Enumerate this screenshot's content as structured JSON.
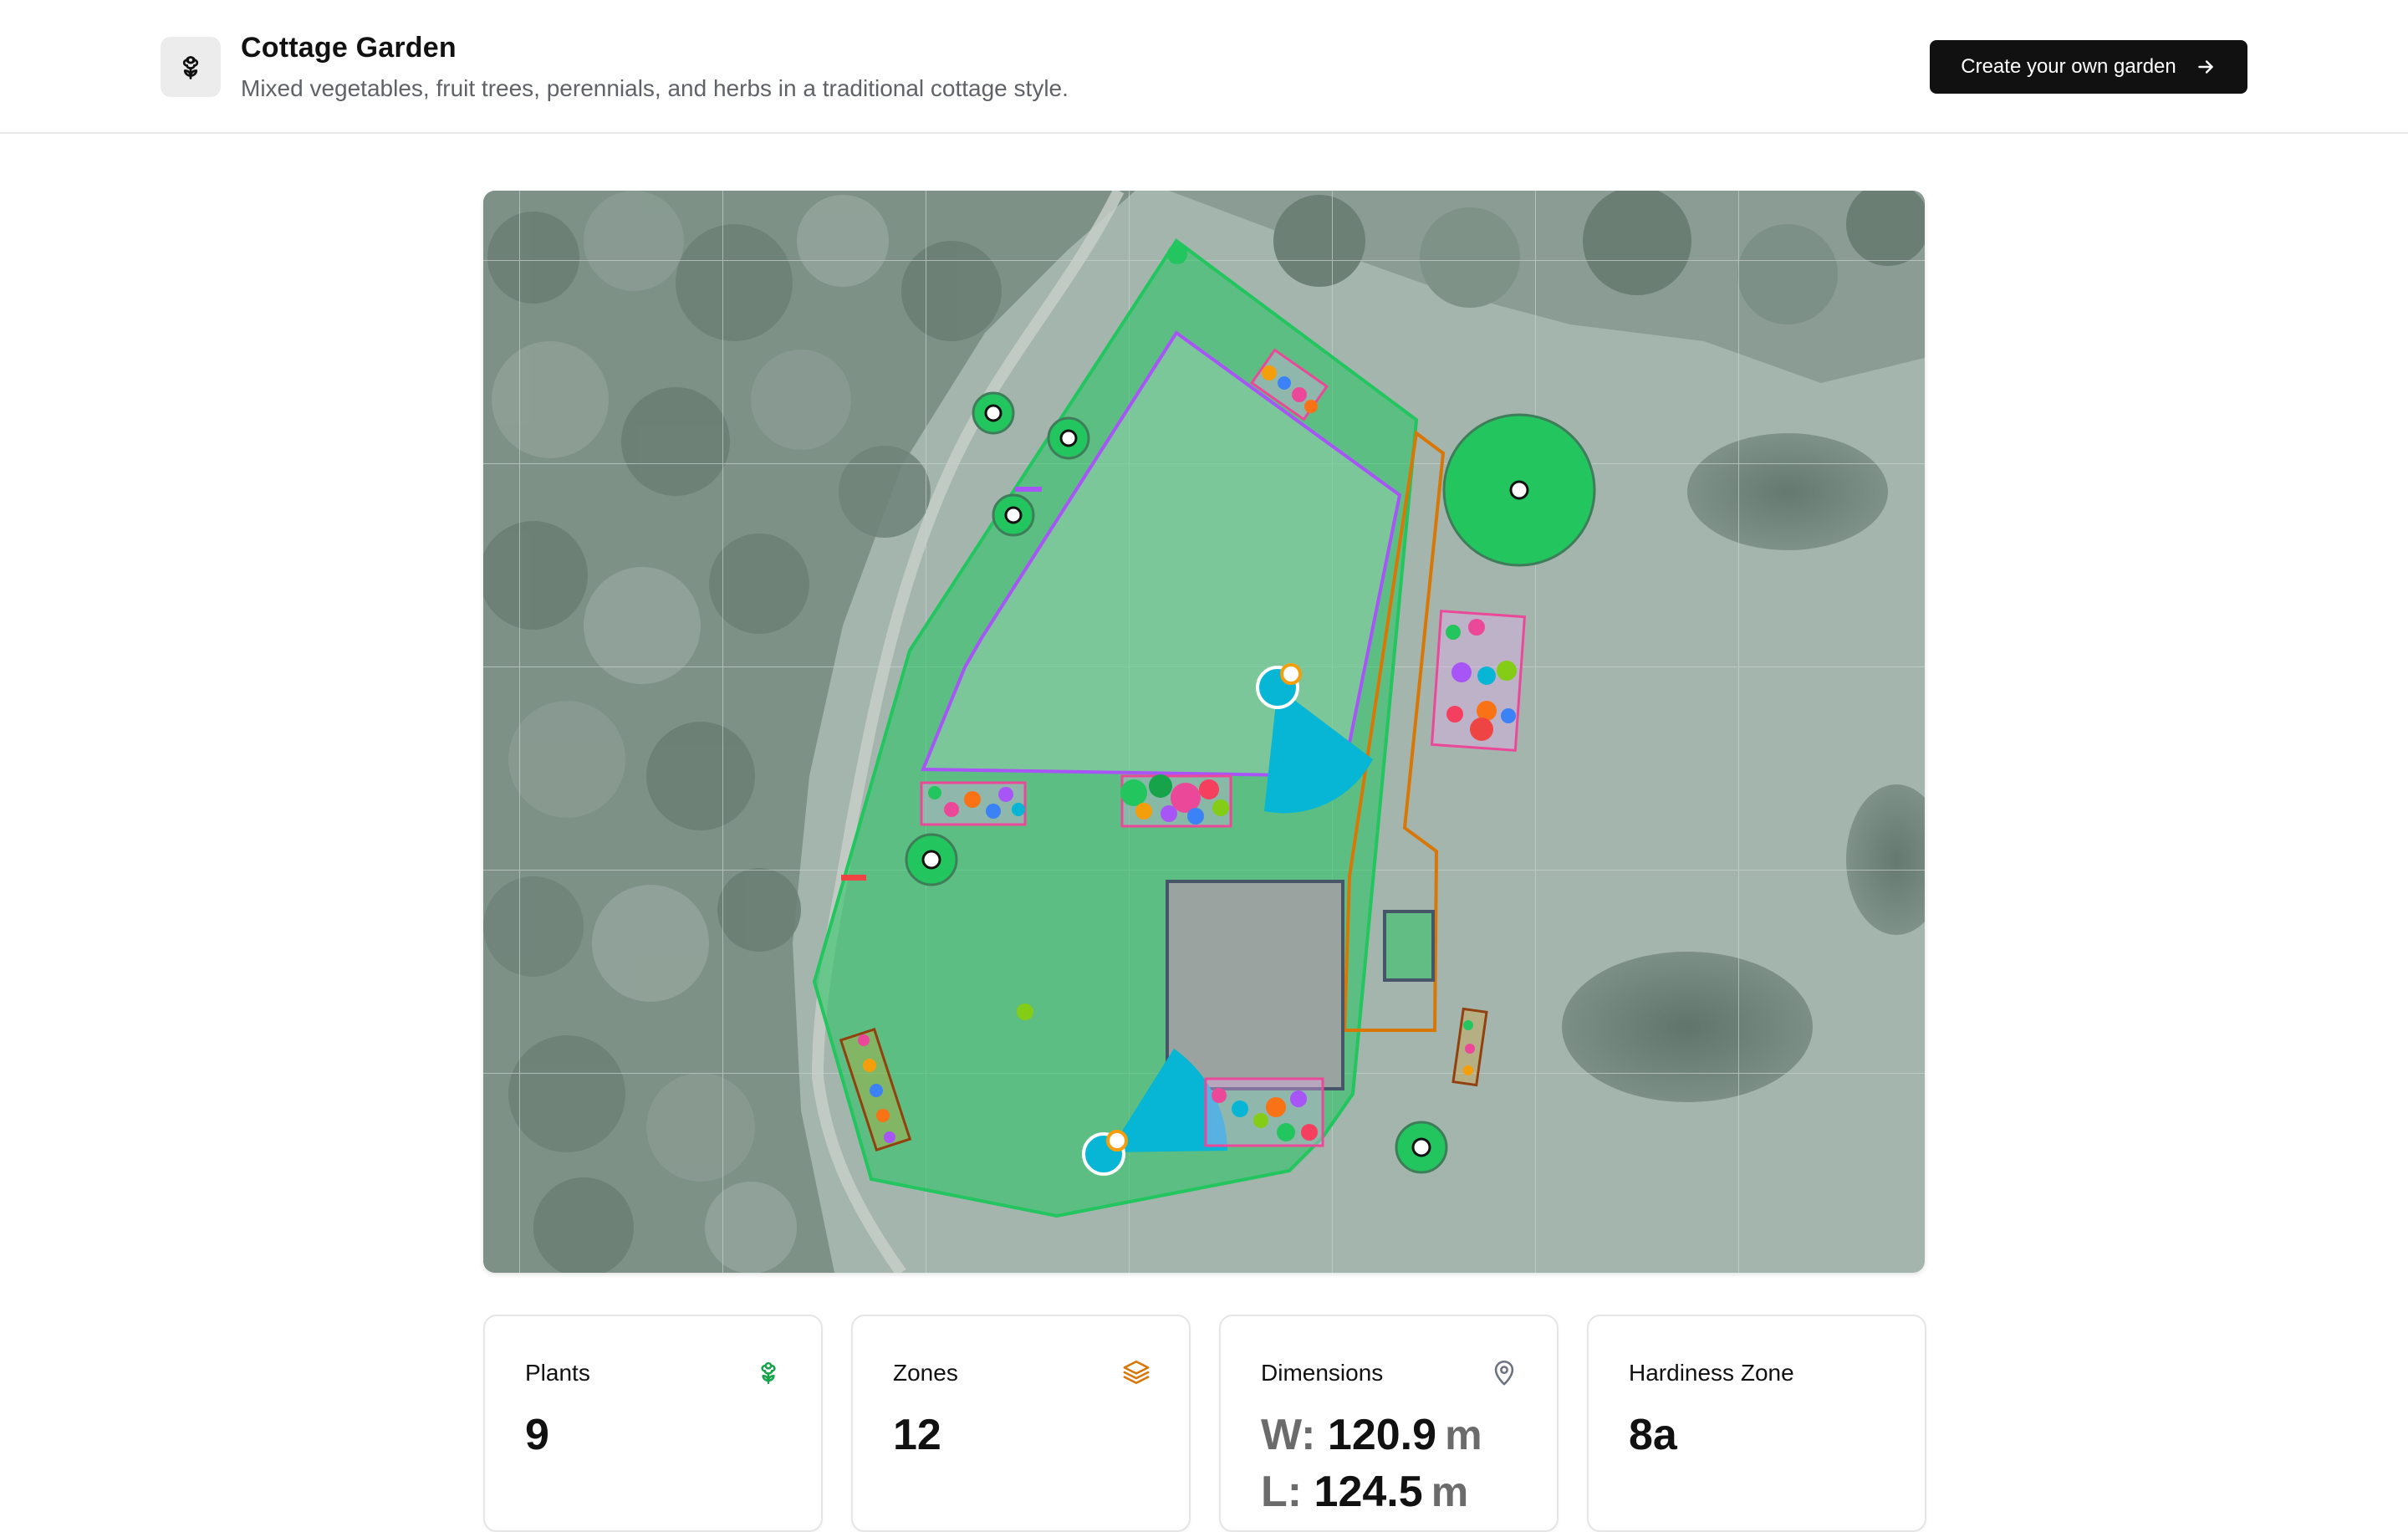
{
  "header": {
    "title": "Cottage Garden",
    "subtitle": "Mixed vegetables, fruit trees, perennials, and herbs in a traditional cottage style.",
    "cta_label": "Create your own garden",
    "logo_icon": "flower-icon",
    "cta_icon": "arrow-right-icon"
  },
  "colors": {
    "garden_fill": "#22c55e",
    "zone_purple": "#a855f7",
    "zone_orange": "#d97706",
    "bed_pink": "#ec4899",
    "water_cyan": "#06b6d4",
    "building": "#475569",
    "accent_orange": "#f59e0b"
  },
  "stats": [
    {
      "label": "Plants",
      "value": "9",
      "icon": "flower-icon",
      "icon_color": "#16a34a"
    },
    {
      "label": "Zones",
      "value": "12",
      "icon": "layers-icon",
      "icon_color": "#d97706"
    },
    {
      "label": "Dimensions",
      "width_key": "W:",
      "width_value": "120.9",
      "length_key": "L:",
      "length_value": "124.5",
      "unit": "m",
      "icon": "map-pin-icon",
      "icon_color": "#6b7280"
    },
    {
      "label": "Hardiness Zone",
      "value": "8a"
    }
  ]
}
